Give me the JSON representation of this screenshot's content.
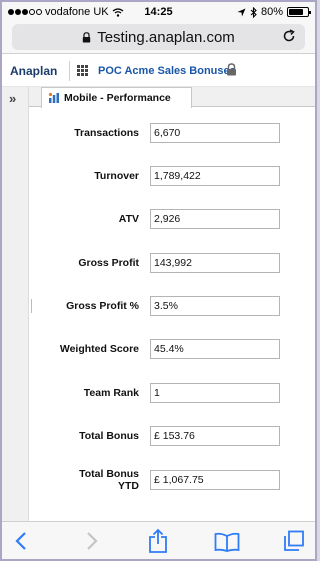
{
  "status": {
    "carrier": "vodafone UK",
    "time": "14:25",
    "battery": "80%",
    "battery_level": 0.8
  },
  "browser": {
    "url": "Testing.anaplan.com"
  },
  "app": {
    "logo": "Anaplan",
    "model": "POC Acme Sales Bonuses"
  },
  "tab": {
    "label": "Mobile - Performance"
  },
  "form": {
    "rows": [
      {
        "label": "Transactions",
        "value": "6,670"
      },
      {
        "label": "Turnover",
        "value": "1,789,422"
      },
      {
        "label": "ATV",
        "value": "2,926"
      },
      {
        "label": "Gross Profit",
        "value": "143,992"
      },
      {
        "label": "Gross Profit %",
        "value": "3.5%"
      },
      {
        "label": "Weighted Score",
        "value": "45.4%"
      },
      {
        "label": "Team Rank",
        "value": "1"
      },
      {
        "label": "Total Bonus",
        "value": "£ 153.76"
      },
      {
        "label": "Total Bonus YTD",
        "value": "£ 1,067.75"
      }
    ]
  },
  "colors": {
    "link": "#1a56a8",
    "ios_blue": "#2f7cf6"
  }
}
